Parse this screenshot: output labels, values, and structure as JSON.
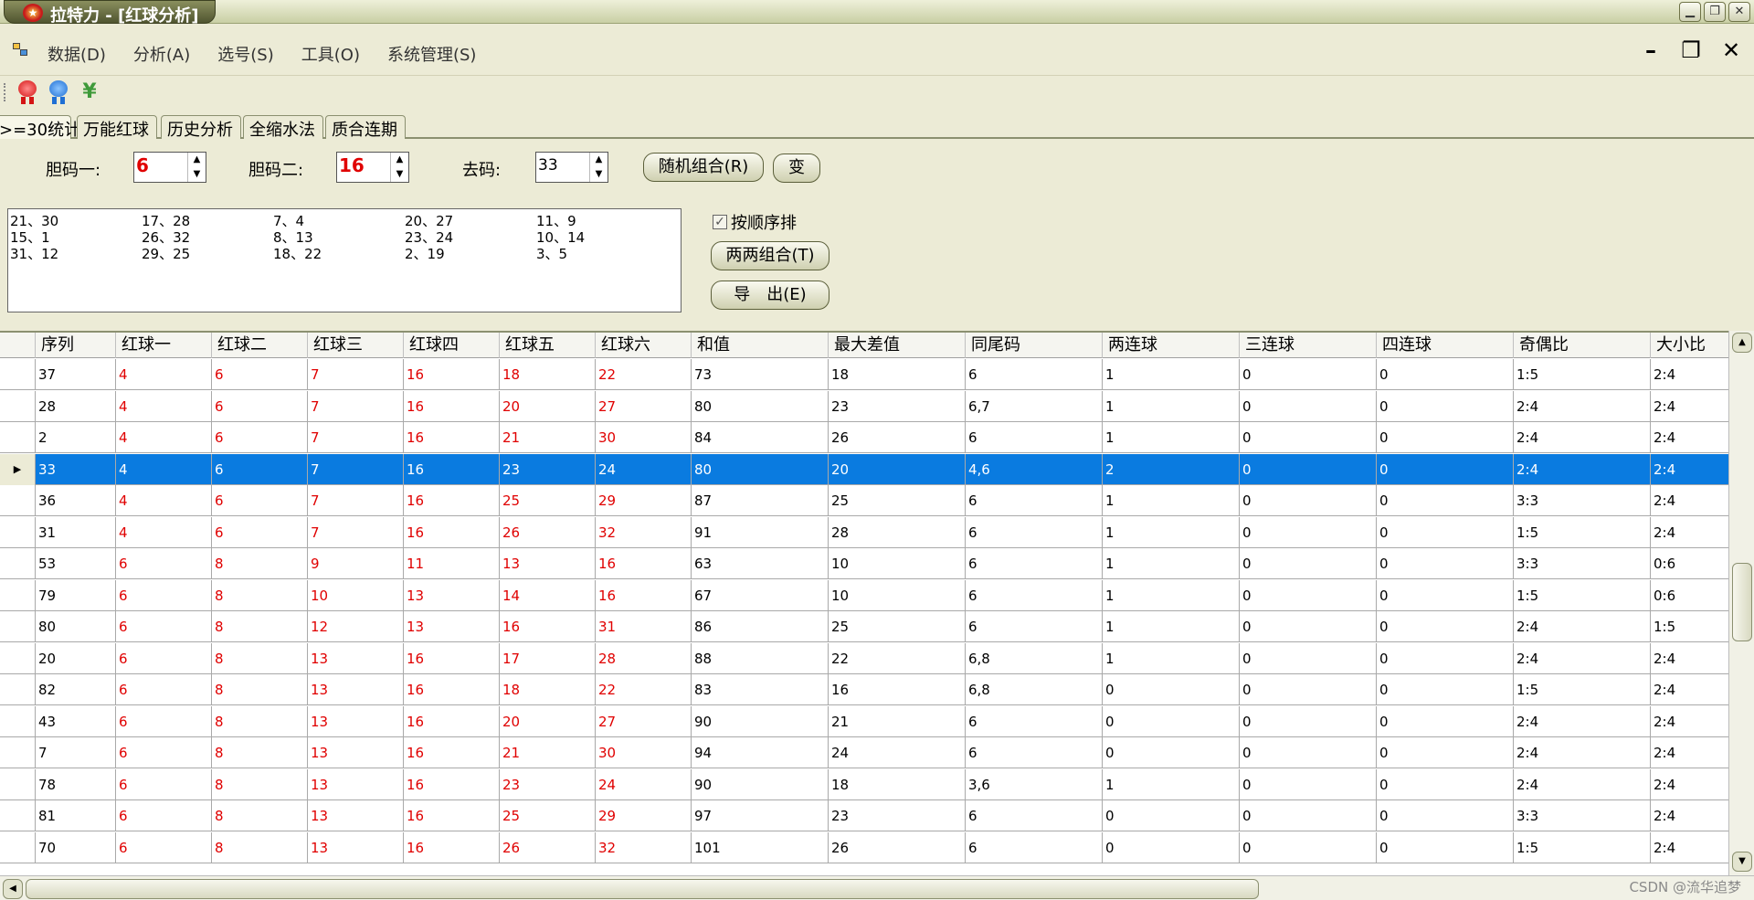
{
  "window": {
    "title": "拉特力 - [红球分析]",
    "controls": {
      "minimize": "▁",
      "restore": "❐",
      "close": "✕"
    }
  },
  "menu": {
    "items": [
      "数据(D)",
      "分析(A)",
      "选号(S)",
      "工具(O)",
      "系统管理(S)"
    ],
    "mdi": {
      "minimize": "–",
      "restore": "❐",
      "close": "✕"
    }
  },
  "toolbar": {
    "icons": [
      "red-ribbon-icon",
      "blue-ribbon-icon",
      "yen-icon"
    ],
    "yen": "¥"
  },
  "tabs": [
    ">=30统计",
    "万能红球",
    "历史分析",
    "全缩水法",
    "质合连期"
  ],
  "controls": {
    "dan1_label": "胆码一:",
    "dan1_value": "6",
    "dan2_label": "胆码二:",
    "dan2_value": "16",
    "qu_label": "去码:",
    "qu_value": "33",
    "random_btn": "随机组合(R)",
    "change_btn": "变",
    "order_chk": "按顺序排",
    "pair_btn": "两两组合(T)",
    "export_btn": "导　出(E)"
  },
  "pairs": [
    [
      "21、30",
      "17、28",
      "7、4",
      "20、27",
      "11、9"
    ],
    [
      "15、1",
      "26、32",
      "8、13",
      "23、24",
      "10、14"
    ],
    [
      "31、12",
      "29、25",
      "18、22",
      "2、19",
      "3、5"
    ]
  ],
  "grid": {
    "columns": [
      "序列",
      "红球一",
      "红球二",
      "红球三",
      "红球四",
      "红球五",
      "红球六",
      "和值",
      "最大差值",
      "同尾码",
      "两连球",
      "三连球",
      "四连球",
      "奇偶比",
      "大小比"
    ],
    "selected_row_index": 3,
    "rows": [
      [
        "37",
        "4",
        "6",
        "7",
        "16",
        "18",
        "22",
        "73",
        "18",
        "6",
        "1",
        "0",
        "0",
        "1:5",
        "2:4"
      ],
      [
        "28",
        "4",
        "6",
        "7",
        "16",
        "20",
        "27",
        "80",
        "23",
        "6,7",
        "1",
        "0",
        "0",
        "2:4",
        "2:4"
      ],
      [
        "2",
        "4",
        "6",
        "7",
        "16",
        "21",
        "30",
        "84",
        "26",
        "6",
        "1",
        "0",
        "0",
        "2:4",
        "2:4"
      ],
      [
        "33",
        "4",
        "6",
        "7",
        "16",
        "23",
        "24",
        "80",
        "20",
        "4,6",
        "2",
        "0",
        "0",
        "2:4",
        "2:4"
      ],
      [
        "36",
        "4",
        "6",
        "7",
        "16",
        "25",
        "29",
        "87",
        "25",
        "6",
        "1",
        "0",
        "0",
        "3:3",
        "2:4"
      ],
      [
        "31",
        "4",
        "6",
        "7",
        "16",
        "26",
        "32",
        "91",
        "28",
        "6",
        "1",
        "0",
        "0",
        "1:5",
        "2:4"
      ],
      [
        "53",
        "6",
        "8",
        "9",
        "11",
        "13",
        "16",
        "63",
        "10",
        "6",
        "1",
        "0",
        "0",
        "3:3",
        "0:6"
      ],
      [
        "79",
        "6",
        "8",
        "10",
        "13",
        "14",
        "16",
        "67",
        "10",
        "6",
        "1",
        "0",
        "0",
        "1:5",
        "0:6"
      ],
      [
        "80",
        "6",
        "8",
        "12",
        "13",
        "16",
        "31",
        "86",
        "25",
        "6",
        "1",
        "0",
        "0",
        "2:4",
        "1:5"
      ],
      [
        "20",
        "6",
        "8",
        "13",
        "16",
        "17",
        "28",
        "88",
        "22",
        "6,8",
        "1",
        "0",
        "0",
        "2:4",
        "2:4"
      ],
      [
        "82",
        "6",
        "8",
        "13",
        "16",
        "18",
        "22",
        "83",
        "16",
        "6,8",
        "0",
        "0",
        "0",
        "1:5",
        "2:4"
      ],
      [
        "43",
        "6",
        "8",
        "13",
        "16",
        "20",
        "27",
        "90",
        "21",
        "6",
        "0",
        "0",
        "0",
        "2:4",
        "2:4"
      ],
      [
        "7",
        "6",
        "8",
        "13",
        "16",
        "21",
        "30",
        "94",
        "24",
        "6",
        "0",
        "0",
        "0",
        "2:4",
        "2:4"
      ],
      [
        "78",
        "6",
        "8",
        "13",
        "16",
        "23",
        "24",
        "90",
        "18",
        "3,6",
        "1",
        "0",
        "0",
        "2:4",
        "2:4"
      ],
      [
        "81",
        "6",
        "8",
        "13",
        "16",
        "25",
        "29",
        "97",
        "23",
        "6",
        "0",
        "0",
        "0",
        "3:3",
        "2:4"
      ],
      [
        "70",
        "6",
        "8",
        "13",
        "16",
        "26",
        "32",
        "101",
        "26",
        "6",
        "0",
        "0",
        "0",
        "1:5",
        "2:4"
      ]
    ]
  },
  "watermark": "CSDN @流华追梦",
  "colors": {
    "red_ball": "#e00000",
    "selection": "#0a7be0"
  }
}
